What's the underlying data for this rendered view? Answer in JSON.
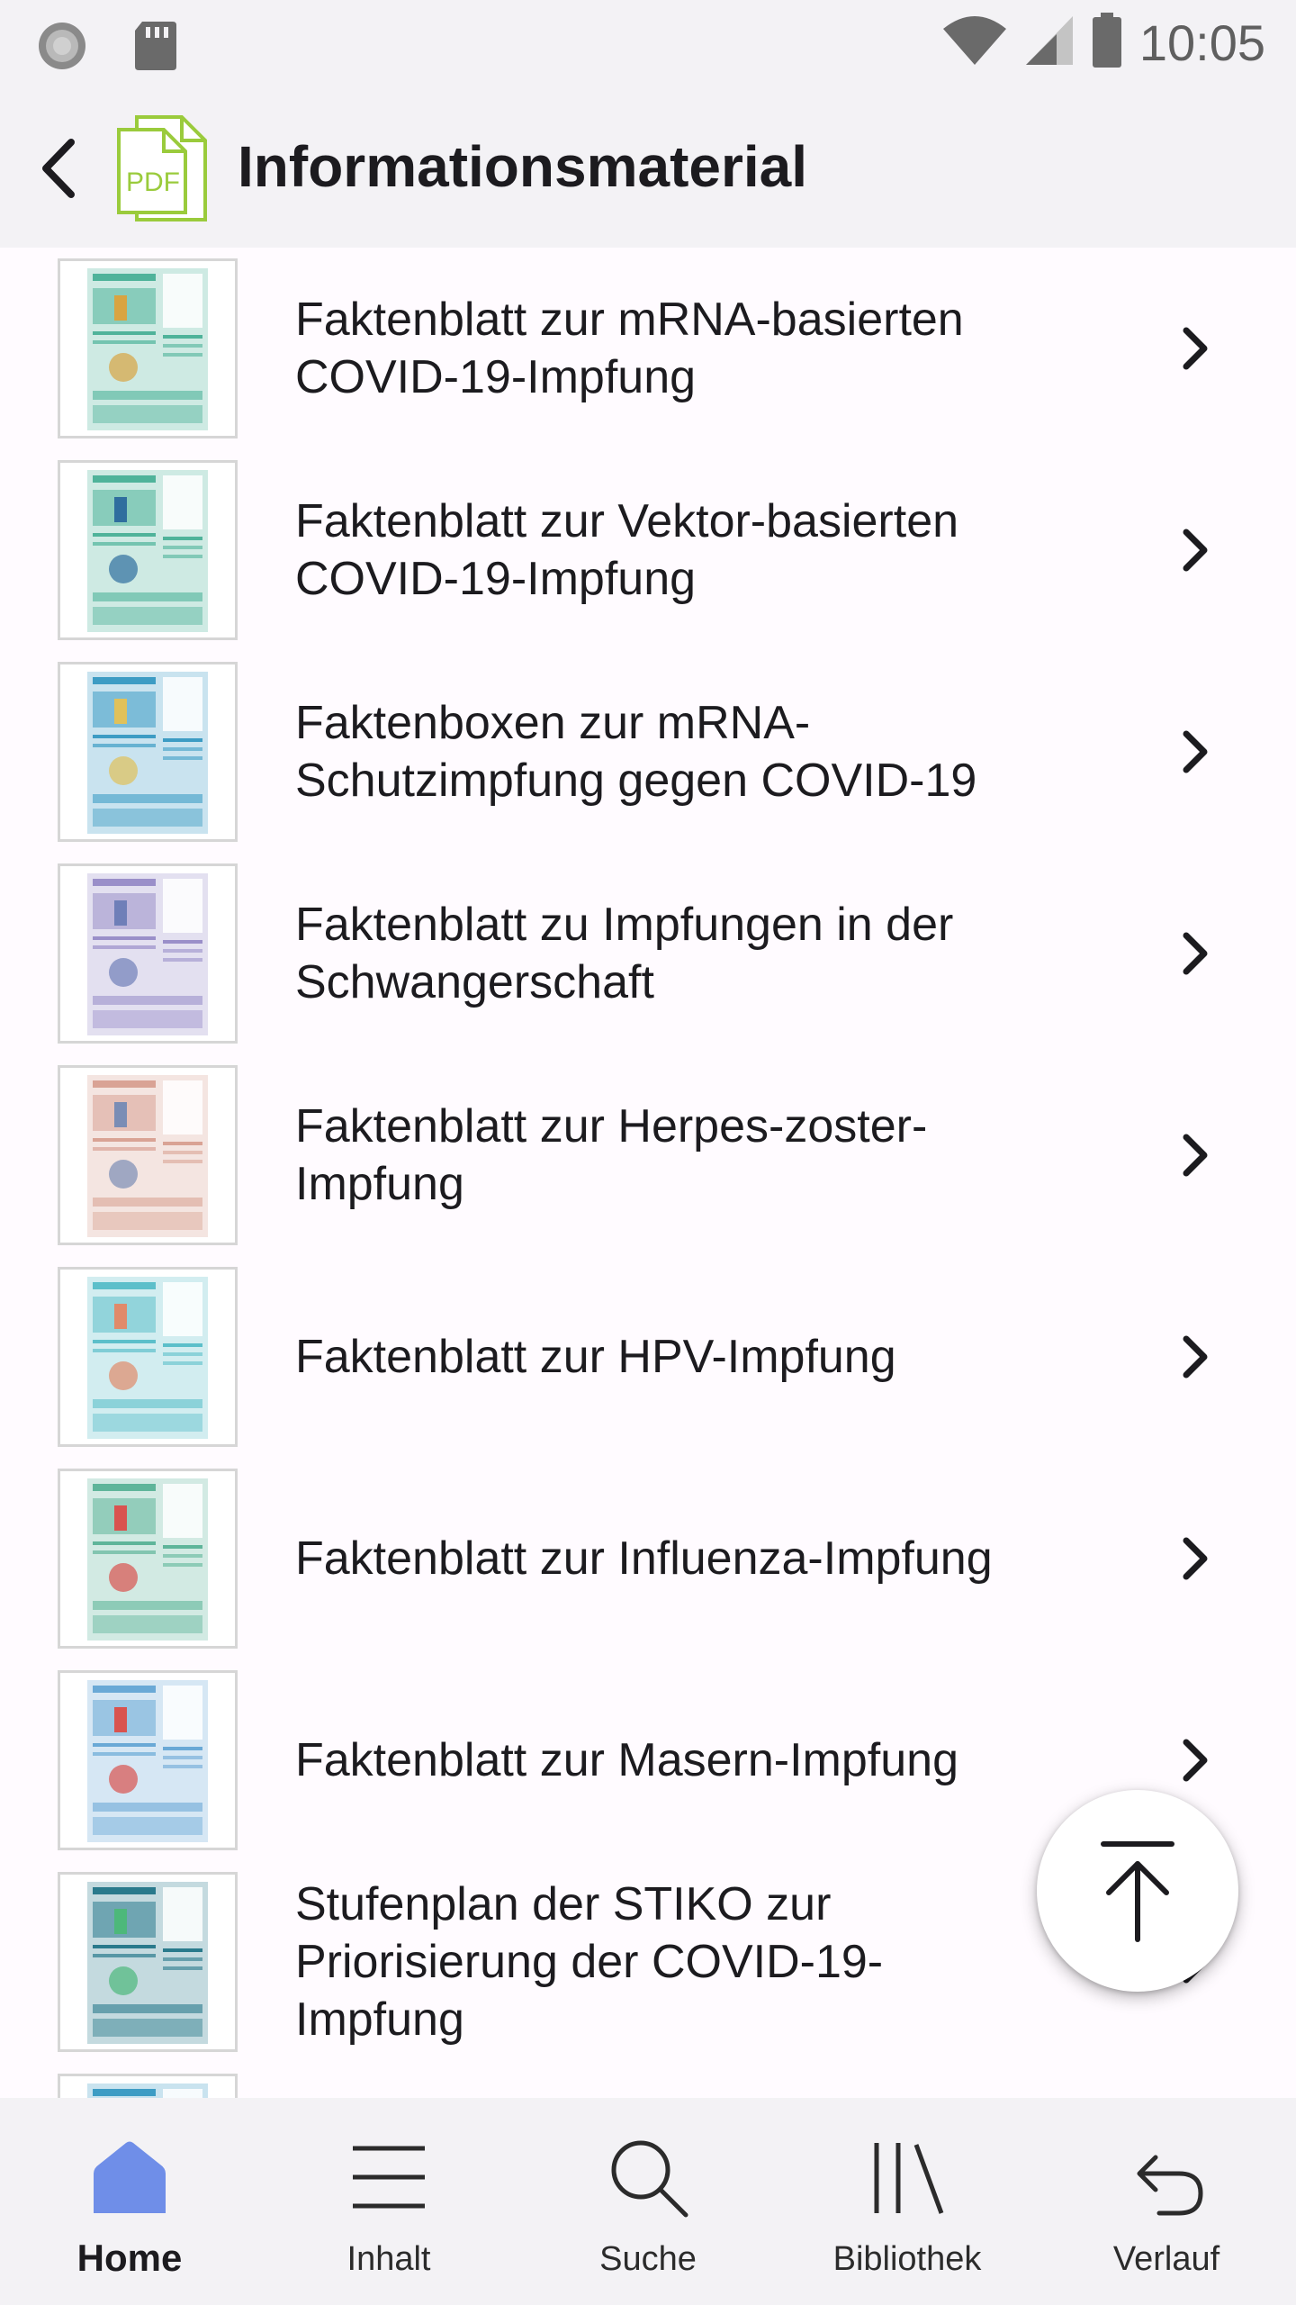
{
  "status_bar": {
    "time": "10:05",
    "icons": [
      "sync-icon",
      "sd-card-icon",
      "wifi-icon",
      "cellular-signal-icon",
      "battery-icon"
    ]
  },
  "app_bar": {
    "title": "Informationsmaterial",
    "back_icon": "back-arrow-icon",
    "logo_icon": "pdf-document-icon",
    "logo_text": "PDF"
  },
  "list": {
    "items": [
      {
        "label": "Faktenblatt zur mRNA-basierten\nCOVID-19-Impfung",
        "thumb_color": "#4fb39a",
        "thumb_accent": "#d9a441"
      },
      {
        "label": "Faktenblatt zur Vektor-basierten\nCOVID-19-Impfung",
        "thumb_color": "#4fb39a",
        "thumb_accent": "#2f6e9e"
      },
      {
        "label": "Faktenboxen zur mRNA-\nSchutzimpfung gegen COVID-19",
        "thumb_color": "#3d9cc4",
        "thumb_accent": "#e0c15a"
      },
      {
        "label": "Faktenblatt zu Impfungen in der\nSchwangerschaft",
        "thumb_color": "#9a8fc9",
        "thumb_accent": "#6f7fb8"
      },
      {
        "label": "Faktenblatt zur Herpes-zoster-\nImpfung",
        "thumb_color": "#d9a395",
        "thumb_accent": "#7a8db5"
      },
      {
        "label": "Faktenblatt zur HPV-Impfung",
        "thumb_color": "#5cbfca",
        "thumb_accent": "#e08a6a"
      },
      {
        "label": "Faktenblatt zur Influenza-Impfung",
        "thumb_color": "#5fb59a",
        "thumb_accent": "#d9534f"
      },
      {
        "label": "Faktenblatt zur Masern-Impfung",
        "thumb_color": "#6aa9d6",
        "thumb_accent": "#d9534f"
      },
      {
        "label": "Stufenplan der STIKO zur\nPriorisierung der COVID-19-\nImpfung",
        "thumb_color": "#2a7a8c",
        "thumb_accent": "#4db87a"
      },
      {
        "label": "",
        "thumb_color": "#3d9cc4",
        "thumb_accent": "#4fb39a"
      }
    ],
    "chevron_icon": "chevron-right-icon"
  },
  "fab": {
    "icon": "scroll-to-top-icon"
  },
  "bottom_nav": {
    "items": [
      {
        "label": "Home",
        "icon": "home-icon",
        "active": true,
        "color": "#6f8ee8"
      },
      {
        "label": "Inhalt",
        "icon": "menu-lines-icon",
        "active": false
      },
      {
        "label": "Suche",
        "icon": "search-icon",
        "active": false
      },
      {
        "label": "Bibliothek",
        "icon": "library-icon",
        "active": false
      },
      {
        "label": "Verlauf",
        "icon": "history-undo-icon",
        "active": false
      }
    ]
  }
}
